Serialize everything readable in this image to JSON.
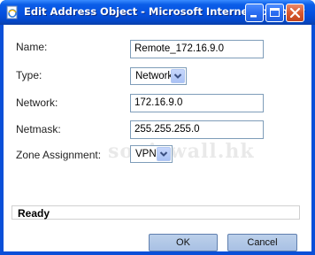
{
  "window": {
    "title": "Edit Address Object - Microsoft Internet Explorer",
    "icon": "ie-page-icon",
    "controls": [
      "minimize-icon",
      "maximize-icon",
      "close-icon"
    ]
  },
  "form": {
    "name_label": "Name:",
    "name_value": "Remote_172.16.9.0",
    "type_label": "Type:",
    "type_value": "Network",
    "network_label": "Network:",
    "network_value": "172.16.9.0",
    "netmask_label": "Netmask:",
    "netmask_value": "255.255.255.0",
    "zone_label": "Zone Assignment:",
    "zone_value": "VPN"
  },
  "status": {
    "text": "Ready"
  },
  "buttons": {
    "ok": "OK",
    "cancel": "Cancel"
  },
  "watermark": "sonicwall.hk",
  "colors": {
    "titlebar": "#0550e0",
    "close_button": "#d9582e",
    "button_face": "#a8c0e4",
    "field_border": "#7f9db9"
  }
}
